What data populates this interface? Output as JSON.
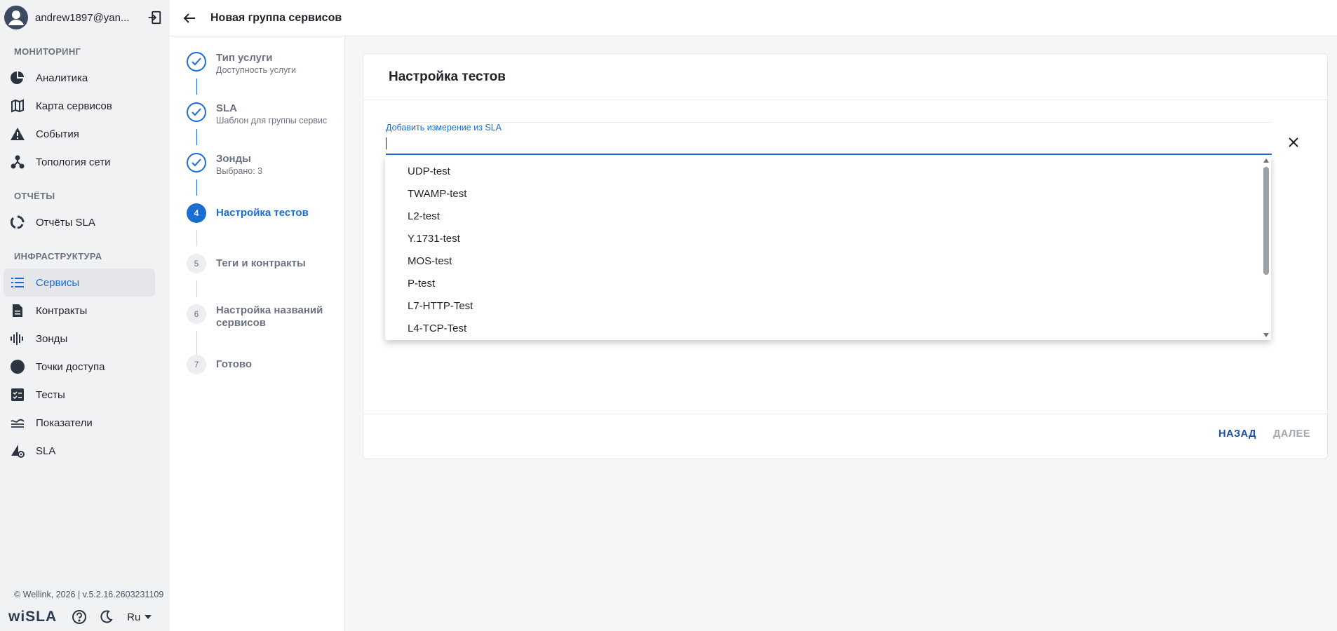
{
  "user": {
    "name": "andrew1897@yan..."
  },
  "sidebar": {
    "sections": {
      "monitoring": "МОНИТОРИНГ",
      "reports": "ОТЧЁТЫ",
      "infrastructure": "ИНФРАСТРУКТУРА"
    },
    "items": {
      "analytics": "Аналитика",
      "service_map": "Карта сервисов",
      "events": "События",
      "topology": "Топология сети",
      "sla_reports": "Отчёты SLA",
      "services": "Сервисы",
      "contracts": "Контракты",
      "probes": "Зонды",
      "access_points": "Точки доступа",
      "tests": "Тесты",
      "metrics": "Показатели",
      "sla": "SLA"
    },
    "active_item": "services",
    "footer": {
      "copyright": "© Wellink, 2026 | v.5.2.16.2603231109",
      "logo": "wiSLA",
      "language": "Ru"
    }
  },
  "header": {
    "title": "Новая группа сервисов"
  },
  "stepper": {
    "steps": [
      {
        "num": "1",
        "title": "Тип услуги",
        "subtitle": "Доступность услуги",
        "state": "done"
      },
      {
        "num": "2",
        "title": "SLA",
        "subtitle": "Шаблон для группы сервис",
        "state": "done"
      },
      {
        "num": "3",
        "title": "Зонды",
        "subtitle": "Выбрано: 3",
        "state": "done"
      },
      {
        "num": "4",
        "title": "Настройка тестов",
        "subtitle": "",
        "state": "current"
      },
      {
        "num": "5",
        "title": "Теги и контракты",
        "subtitle": "",
        "state": "todo"
      },
      {
        "num": "6",
        "title": "Настройка названий сервисов",
        "subtitle": "",
        "state": "todo"
      },
      {
        "num": "7",
        "title": "Готово",
        "subtitle": "",
        "state": "todo"
      }
    ]
  },
  "card": {
    "title": "Настройка тестов",
    "field": {
      "label": "Добавить измерение из SLA",
      "value": ""
    },
    "dropdown_options": [
      "UDP-test",
      "TWAMP-test",
      "L2-test",
      "Y.1731-test",
      "MOS-test",
      "P-test",
      "L7-HTTP-Test",
      "L4-TCP-Test"
    ],
    "buttons": {
      "back": "НАЗАД",
      "next": "ДАЛЕЕ"
    }
  },
  "colors": {
    "accent": "#1a6dd1",
    "disabled": "#a3a9b2",
    "sidebar_bg": "#f1f2f4"
  }
}
